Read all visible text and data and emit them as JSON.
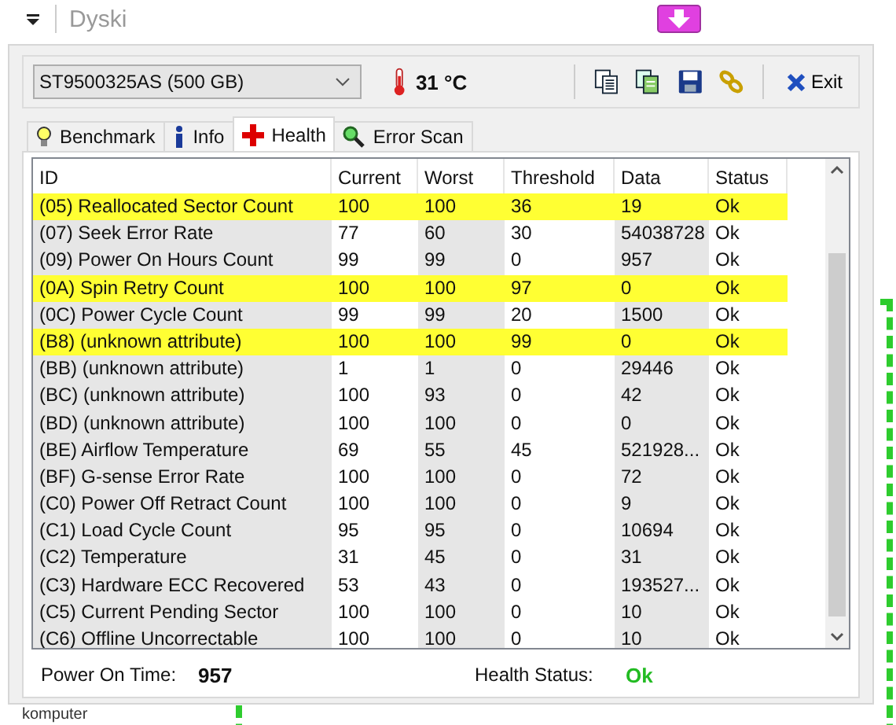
{
  "explorer": {
    "title": "Dyski",
    "below_label": "komputer"
  },
  "drive": {
    "value": "ST9500325AS (500 GB)"
  },
  "temperature": "31 °C",
  "toolbar": {
    "exit_label": "Exit"
  },
  "tabs": [
    {
      "label": "Benchmark",
      "selected": false
    },
    {
      "label": "Info",
      "selected": false
    },
    {
      "label": "Health",
      "selected": true
    },
    {
      "label": "Error Scan",
      "selected": false
    }
  ],
  "table": {
    "columns": [
      "ID",
      "Current",
      "Worst",
      "Threshold",
      "Data",
      "Status"
    ],
    "rows": [
      {
        "cells": [
          "(05) Reallocated Sector Count",
          "100",
          "100",
          "36",
          "19",
          "Ok"
        ],
        "warning": true
      },
      {
        "cells": [
          "(07) Seek Error Rate",
          "77",
          "60",
          "30",
          "54038728",
          "Ok"
        ],
        "warning": false
      },
      {
        "cells": [
          "(09) Power On Hours Count",
          "99",
          "99",
          "0",
          "957",
          "Ok"
        ],
        "warning": false
      },
      {
        "cells": [
          "(0A) Spin Retry Count",
          "100",
          "100",
          "97",
          "0",
          "Ok"
        ],
        "warning": true
      },
      {
        "cells": [
          "(0C) Power Cycle Count",
          "99",
          "99",
          "20",
          "1500",
          "Ok"
        ],
        "warning": false
      },
      {
        "cells": [
          "(B8) (unknown attribute)",
          "100",
          "100",
          "99",
          "0",
          "Ok"
        ],
        "warning": true
      },
      {
        "cells": [
          "(BB) (unknown attribute)",
          "1",
          "1",
          "0",
          "29446",
          "Ok"
        ],
        "warning": false
      },
      {
        "cells": [
          "(BC) (unknown attribute)",
          "100",
          "93",
          "0",
          "42",
          "Ok"
        ],
        "warning": false
      },
      {
        "cells": [
          "(BD) (unknown attribute)",
          "100",
          "100",
          "0",
          "0",
          "Ok"
        ],
        "warning": false
      },
      {
        "cells": [
          "(BE) Airflow Temperature",
          "69",
          "55",
          "45",
          "521928...",
          "Ok"
        ],
        "warning": false
      },
      {
        "cells": [
          "(BF) G-sense Error Rate",
          "100",
          "100",
          "0",
          "72",
          "Ok"
        ],
        "warning": false
      },
      {
        "cells": [
          "(C0) Power Off Retract Count",
          "100",
          "100",
          "0",
          "9",
          "Ok"
        ],
        "warning": false
      },
      {
        "cells": [
          "(C1) Load Cycle Count",
          "95",
          "95",
          "0",
          "10694",
          "Ok"
        ],
        "warning": false
      },
      {
        "cells": [
          "(C2) Temperature",
          "31",
          "45",
          "0",
          "31",
          "Ok"
        ],
        "warning": false
      },
      {
        "cells": [
          "(C3) Hardware ECC Recovered",
          "53",
          "43",
          "0",
          "193527...",
          "Ok"
        ],
        "warning": false
      },
      {
        "cells": [
          "(C5) Current Pending Sector",
          "100",
          "100",
          "0",
          "10",
          "Ok"
        ],
        "warning": false
      },
      {
        "cells": [
          "(C6) Offline Uncorrectable",
          "100",
          "100",
          "0",
          "10",
          "Ok"
        ],
        "warning": false
      }
    ]
  },
  "footer": {
    "power_on_label": "Power On Time:",
    "power_on_value": "957",
    "health_label": "Health Status:",
    "health_value": "Ok"
  }
}
